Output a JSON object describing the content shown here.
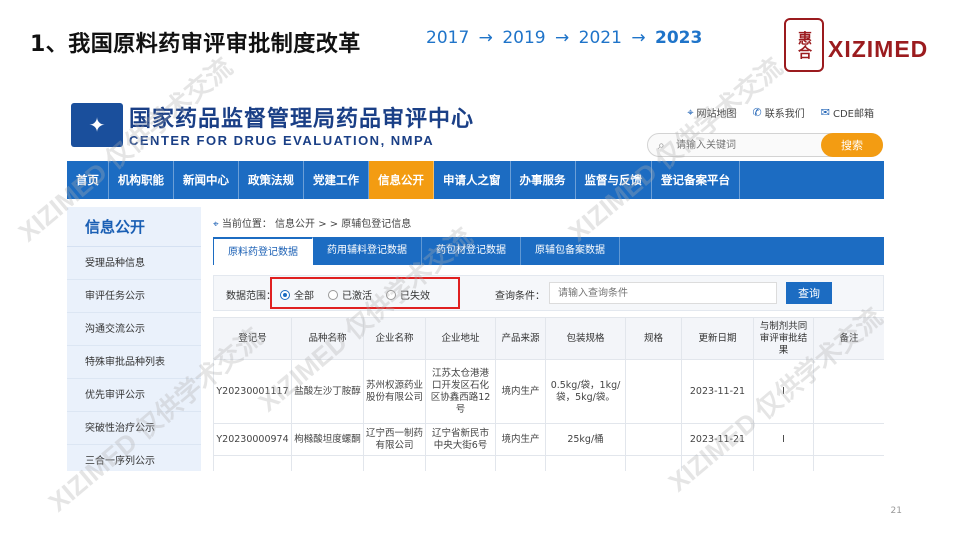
{
  "slide": {
    "title": "1、我国原料药审评审批制度改革",
    "timeline": [
      "2017",
      "→",
      "2019",
      "→",
      "2021",
      "→",
      "2023"
    ],
    "page_number": "21"
  },
  "brand": {
    "seal_text": "惠合",
    "wordmark": "XIZIMED",
    "color": "#9b1b1e"
  },
  "site": {
    "name_cn": "国家药品监督管理局药品审评中心",
    "name_en": "CENTER FOR DRUG EVALUATION, NMPA",
    "top_links": [
      {
        "icon": "location-pin-icon",
        "label": "网站地图"
      },
      {
        "icon": "phone-icon",
        "label": "联系我们"
      },
      {
        "icon": "mail-icon",
        "label": "CDE邮箱"
      }
    ],
    "search": {
      "placeholder": "请输入关键词",
      "button": "搜索"
    },
    "nav": [
      "首页",
      "机构职能",
      "新闻中心",
      "政策法规",
      "党建工作",
      "信息公开",
      "申请人之窗",
      "办事服务",
      "监督与反馈",
      "登记备案平台"
    ],
    "nav_active_index": 5,
    "sidebar": {
      "title": "信息公开",
      "items": [
        "受理品种信息",
        "审评任务公示",
        "沟通交流公示",
        "特殊审批品种列表",
        "优先审评公示",
        "突破性治疗公示",
        "三合一序列公示"
      ]
    },
    "breadcrumb": {
      "prefix": "当前位置：",
      "path": "信息公开 > > 原辅包登记信息"
    },
    "tabs": [
      "原料药登记数据",
      "药用辅料登记数据",
      "药包材登记数据",
      "原辅包备案数据"
    ],
    "tab_active_index": 0,
    "filter": {
      "label": "数据范围：",
      "options": [
        "全部",
        "已激活",
        "已失效"
      ],
      "selected_index": 0,
      "query_label": "查询条件：",
      "query_placeholder": "请输入查询条件",
      "query_button": "查询"
    },
    "table": {
      "headers": [
        "登记号",
        "品种名称",
        "企业名称",
        "企业地址",
        "产品来源",
        "包装规格",
        "规格",
        "更新日期",
        "与制剂共同审评审批结果",
        "备注"
      ],
      "rows": [
        [
          "Y20230001117",
          "盐酸左沙丁胺醇",
          "苏州权源药业股份有限公司",
          "江苏太仓港港口开发区石化区协鑫西路12号",
          "境内生产",
          "0.5kg/袋，1kg/袋，5kg/袋。",
          "",
          "2023-11-21",
          "I",
          ""
        ],
        [
          "Y20230000974",
          "枸橼酸坦度螺酮",
          "辽宁西一制药有限公司",
          "辽宁省新民市中央大街6号",
          "境内生产",
          "25kg/桶",
          "",
          "2023-11-21",
          "I",
          ""
        ],
        [
          "",
          "",
          "",
          "",
          "",
          "",
          "",
          "",
          "",
          ""
        ]
      ]
    }
  },
  "watermark": "XIZIMED 仅供学术交流"
}
